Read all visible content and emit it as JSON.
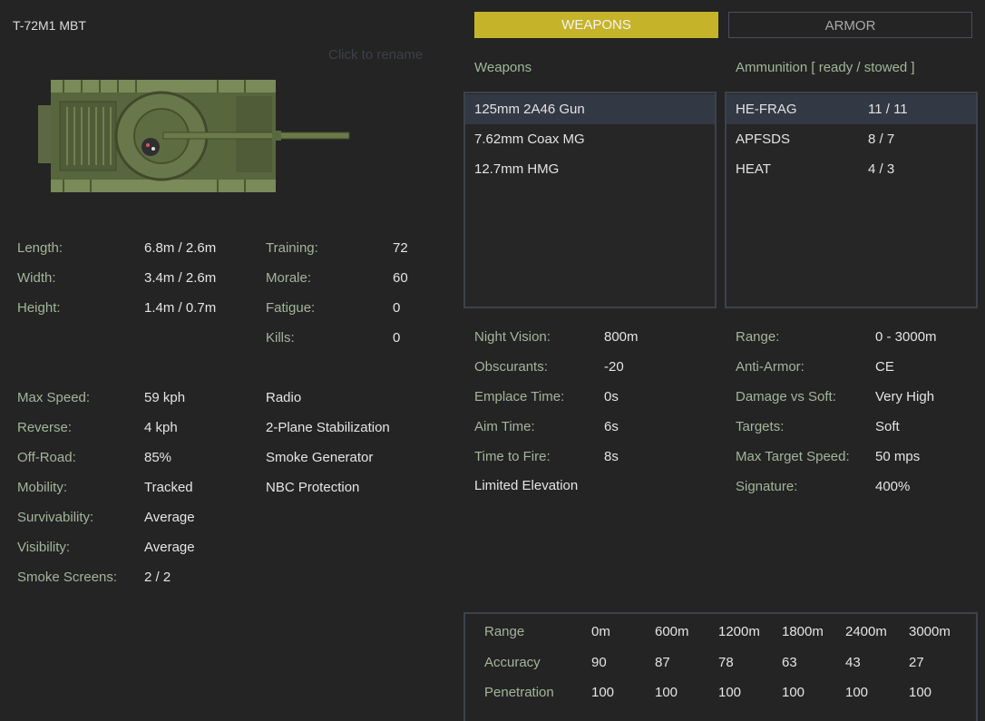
{
  "unit": {
    "name": "T-72M1 MBT",
    "rename_hint": "Click to rename"
  },
  "stats_dims": [
    {
      "label": "Length:",
      "value": "6.8m / 2.6m"
    },
    {
      "label": "Width:",
      "value": "3.4m / 2.6m"
    },
    {
      "label": "Height:",
      "value": "1.4m / 0.7m"
    }
  ],
  "stats_crew": [
    {
      "label": "Training:",
      "value": "72"
    },
    {
      "label": "Morale:",
      "value": "60"
    },
    {
      "label": "Fatigue:",
      "value": "0"
    },
    {
      "label": "Kills:",
      "value": "0"
    }
  ],
  "stats_mobility": [
    {
      "label": "Max Speed:",
      "value": "59 kph"
    },
    {
      "label": "Reverse:",
      "value": "4 kph"
    },
    {
      "label": "Off-Road:",
      "value": "85%"
    },
    {
      "label": "Mobility:",
      "value": "Tracked"
    },
    {
      "label": "Survivability:",
      "value": "Average"
    },
    {
      "label": "Visibility:",
      "value": "Average"
    },
    {
      "label": "Smoke Screens:",
      "value": "2 / 2"
    }
  ],
  "features": [
    "Radio",
    "2-Plane Stabilization",
    "Smoke Generator",
    "NBC Protection"
  ],
  "tabs": {
    "weapons": "WEAPONS",
    "armor": "ARMOR"
  },
  "weapons": {
    "header": "Weapons",
    "items": [
      "125mm 2A46 Gun",
      "7.62mm Coax MG",
      "12.7mm HMG"
    ],
    "selected": 0
  },
  "ammo": {
    "header": "Ammunition [ ready / stowed ]",
    "items": [
      {
        "name": "HE-FRAG",
        "count": "11 / 11"
      },
      {
        "name": "APFSDS",
        "count": "8 / 7"
      },
      {
        "name": "HEAT",
        "count": "4 / 3"
      }
    ],
    "selected": 0
  },
  "weapon_stats": [
    {
      "label": "Night Vision:",
      "value": "800m"
    },
    {
      "label": "Obscurants:",
      "value": "-20"
    },
    {
      "label": "Emplace Time:",
      "value": "0s"
    },
    {
      "label": "Aim Time:",
      "value": "6s"
    },
    {
      "label": "Time to Fire:",
      "value": "8s"
    }
  ],
  "weapon_note": "Limited Elevation",
  "ammo_stats": [
    {
      "label": "Range:",
      "value": "0 - 3000m"
    },
    {
      "label": "Anti-Armor:",
      "value": "CE"
    },
    {
      "label": "Damage vs Soft:",
      "value": "Very High"
    },
    {
      "label": "Targets:",
      "value": "Soft"
    },
    {
      "label": "Max Target Speed:",
      "value": "50 mps"
    },
    {
      "label": "Signature:",
      "value": "400%"
    }
  ],
  "range_table": {
    "rows": [
      {
        "label": "Range",
        "values": [
          "0m",
          "600m",
          "1200m",
          "1800m",
          "2400m",
          "3000m"
        ]
      },
      {
        "label": "Accuracy",
        "values": [
          "90",
          "87",
          "78",
          "63",
          "43",
          "27"
        ]
      },
      {
        "label": "Penetration",
        "values": [
          "100",
          "100",
          "100",
          "100",
          "100",
          "100"
        ]
      }
    ]
  },
  "colors": {
    "accent": "#c5b42a",
    "label": "#a3b59a",
    "selected_row": "#333944"
  }
}
